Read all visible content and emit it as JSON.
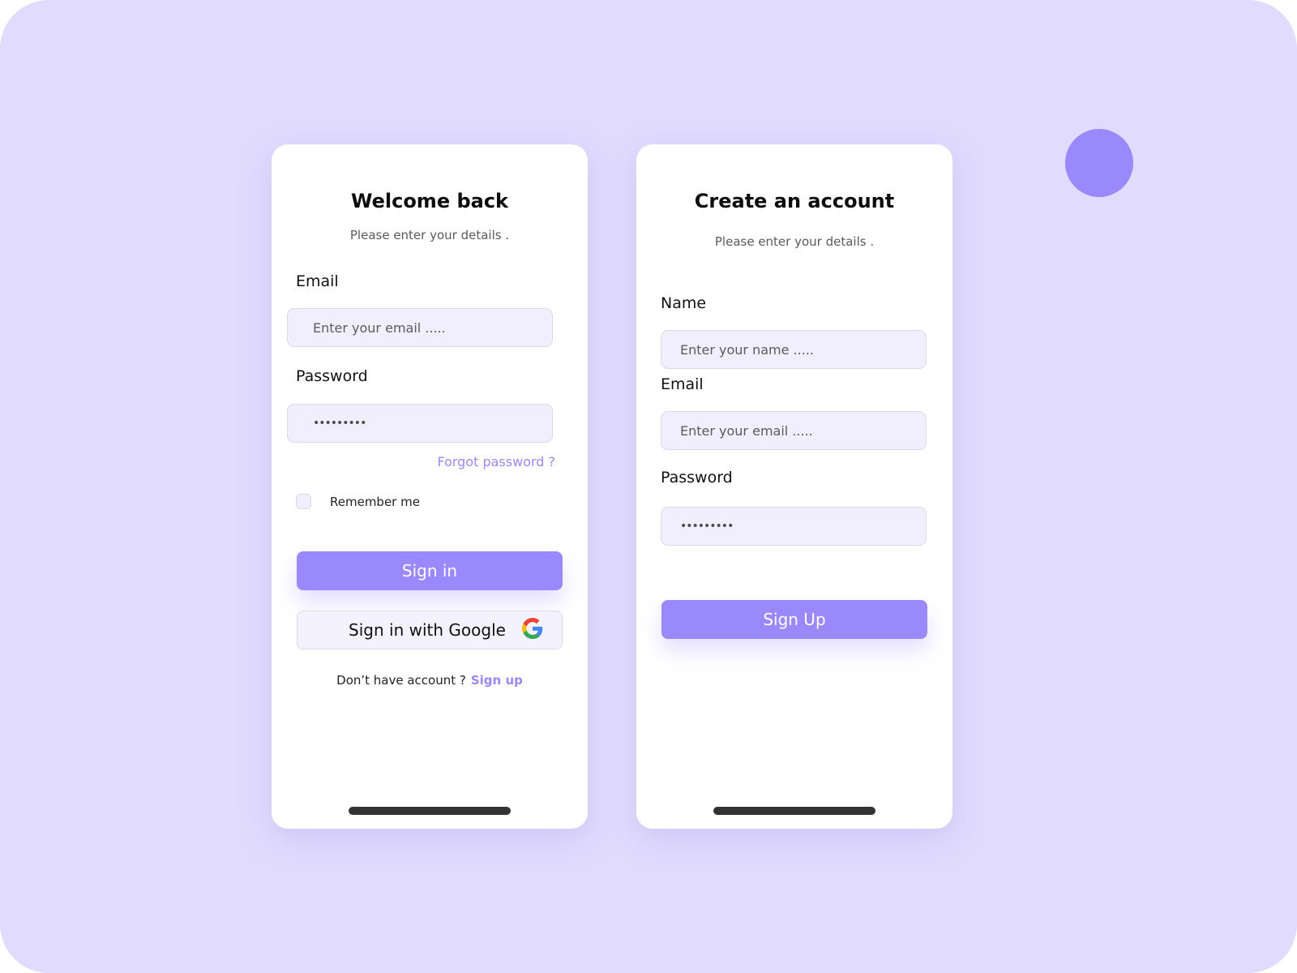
{
  "colors": {
    "background": "#e1dcfd",
    "accent": "#9a88fd",
    "input_bg": "#f1effd",
    "card_bg": "#ffffff"
  },
  "login": {
    "title": "Welcome back",
    "subtitle": "Please enter your details .",
    "email_label": "Email",
    "email_placeholder": "Enter your email .....",
    "password_label": "Password",
    "password_value": "•••••••••",
    "forgot_password": "Forgot password ?",
    "remember_me": "Remember me",
    "remember_checked": false,
    "sign_in_button": "Sign in",
    "google_button": "Sign in with Google",
    "google_icon": "google-g-icon",
    "no_account_text": "Don’t have account ?",
    "sign_up_link": "Sign up"
  },
  "signup": {
    "title": "Create an account",
    "subtitle": "Please enter your details .",
    "name_label": "Name",
    "name_placeholder": "Enter your name  .....",
    "email_label": "Email",
    "email_placeholder": "Enter your email .....",
    "password_label": "Password",
    "password_value": "•••••••••",
    "sign_up_button": "Sign Up"
  }
}
